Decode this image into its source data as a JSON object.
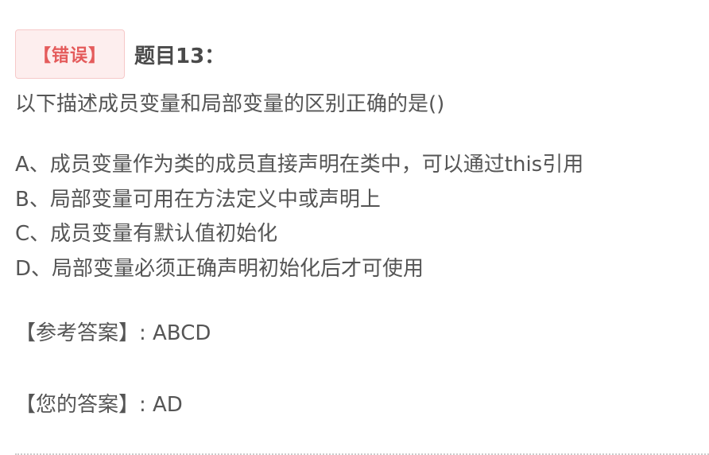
{
  "question": {
    "status_badge": "【错误】",
    "title": "题目13：",
    "text": "以下描述成员变量和局部变量的区别正确的是()",
    "options": [
      "A、成员变量作为类的成员直接声明在类中，可以通过this引用",
      "B、局部变量可用在方法定义中或声明上",
      "C、成员变量有默认值初始化",
      "D、局部变量必须正确声明初始化后才可使用"
    ]
  },
  "answers": {
    "reference": "【参考答案】: ABCD",
    "yours": "【您的答案】: AD"
  },
  "colors": {
    "badge_bg": "#fdeeee",
    "badge_text": "#e45b5b",
    "text": "#555555"
  }
}
